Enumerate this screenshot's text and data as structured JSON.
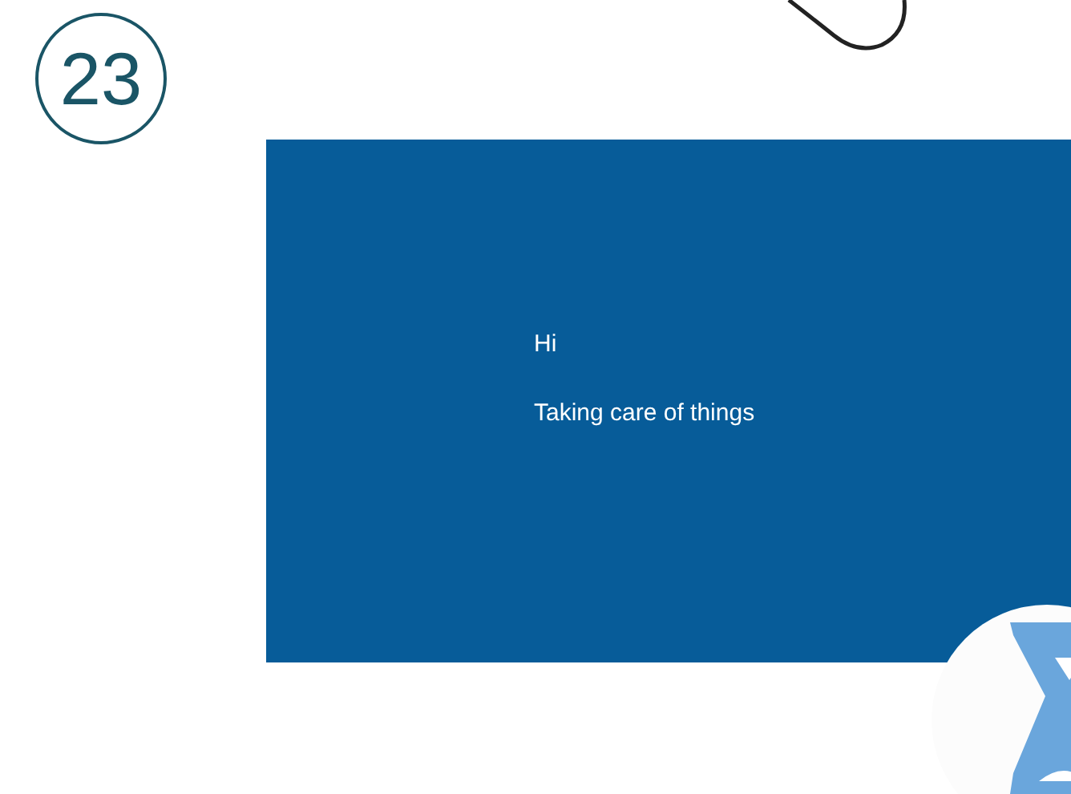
{
  "step_number": "23",
  "setup_screen": {
    "greeting": "Hi",
    "message": "Taking care of things"
  }
}
